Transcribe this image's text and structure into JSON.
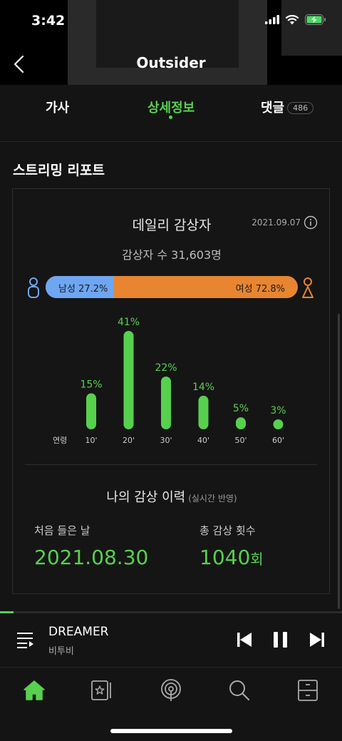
{
  "status_bar": {
    "time": "3:42"
  },
  "nav": {
    "title": "Outsider"
  },
  "tabs": [
    {
      "label": "가사"
    },
    {
      "label": "상세정보"
    },
    {
      "label": "댓글",
      "count": "486"
    }
  ],
  "section": {
    "title": "스트리밍 리포트"
  },
  "daily": {
    "title": "데일리 감상자",
    "date": "2021.09.07",
    "listeners": "감상자 수 31,603명",
    "male_label": "남성 27.2%",
    "female_label": "여성 72.8%",
    "male_fraction": 0.272
  },
  "chart_data": {
    "type": "bar",
    "xlabel": "연령",
    "categories": [
      "10'",
      "20'",
      "30'",
      "40'",
      "50'",
      "60'"
    ],
    "values": [
      15,
      41,
      22,
      14,
      5,
      3
    ],
    "value_labels": [
      "15%",
      "41%",
      "22%",
      "14%",
      "5%",
      "3%"
    ],
    "ylim": [
      0,
      41
    ]
  },
  "history": {
    "title": "나의 감상 이력",
    "subtitle": "(실시간 반영)",
    "first_label": "처음 들은 날",
    "first_value": "2021.08.30",
    "count_label": "총 감상 횟수",
    "count_value": "1040",
    "count_unit": "회"
  },
  "player": {
    "song_title": "DREAMER",
    "artist": "비투비",
    "progress_fraction": 0.04
  },
  "colors": {
    "accent": "#57d14d",
    "male": "#6ea6f2",
    "female": "#e88530"
  }
}
